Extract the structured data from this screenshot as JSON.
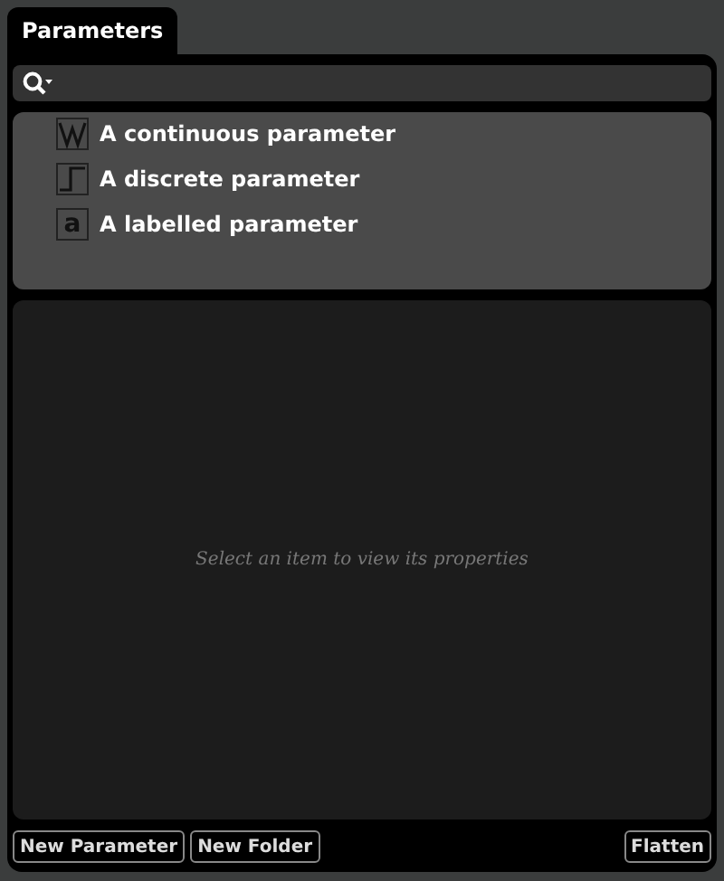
{
  "tab": {
    "label": "Parameters",
    "selected": true
  },
  "parameters": [
    {
      "kind": "continuous",
      "label": "A continuous parameter"
    },
    {
      "kind": "discrete",
      "label": "A discrete parameter"
    },
    {
      "kind": "labelled",
      "label": "A labelled parameter",
      "icon_char": "a"
    }
  ],
  "properties": {
    "placeholder": "Select an item to view its properties"
  },
  "buttons_left": [
    "New Parameter",
    "New Folder"
  ],
  "buttons_right": [
    "Flatten"
  ]
}
